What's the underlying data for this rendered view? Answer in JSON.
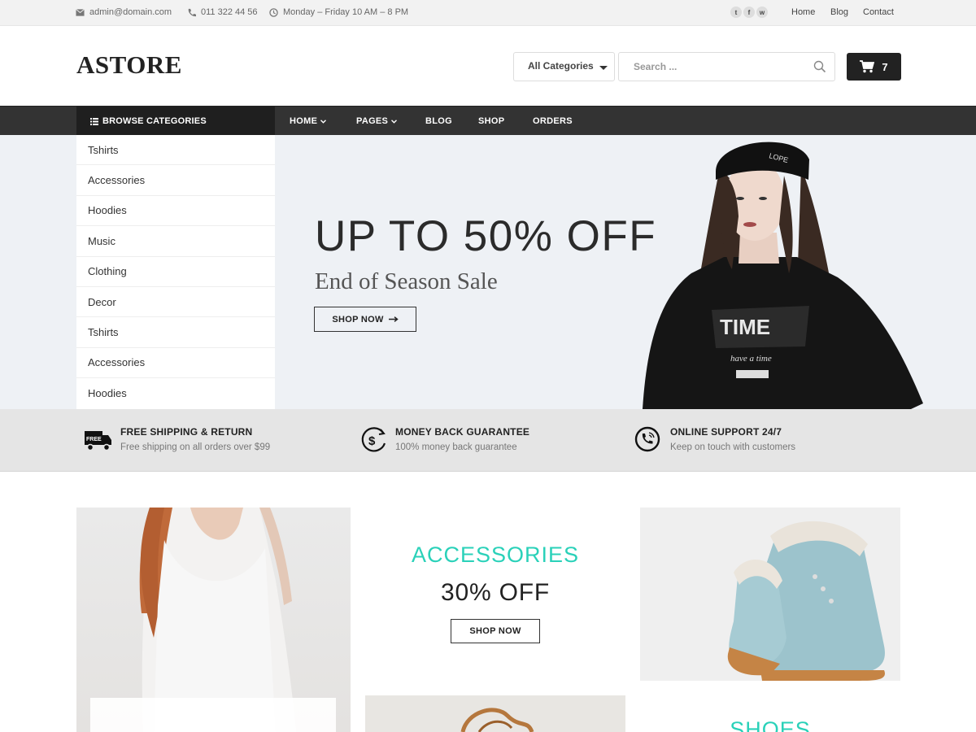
{
  "topbar": {
    "email": "admin@domain.com",
    "phone": "011 322 44 56",
    "hours": "Monday – Friday 10 AM – 8 PM",
    "social": [
      "twitter-icon",
      "facebook-icon",
      "weibo-icon"
    ],
    "links": [
      "Home",
      "Blog",
      "Contact"
    ]
  },
  "header": {
    "logo": "ASTORE",
    "category_select": "All Categories",
    "search_placeholder": "Search ...",
    "cart_count": "7"
  },
  "nav": {
    "browse_label": "BROWSE CATEGORIES",
    "items": [
      {
        "label": "HOME",
        "has_dropdown": true
      },
      {
        "label": "PAGES",
        "has_dropdown": true
      },
      {
        "label": "BLOG",
        "has_dropdown": false
      },
      {
        "label": "SHOP",
        "has_dropdown": false
      },
      {
        "label": "ORDERS",
        "has_dropdown": false
      }
    ]
  },
  "categories": [
    "Tshirts",
    "Accessories",
    "Hoodies",
    "Music",
    "Clothing",
    "Decor",
    "Tshirts",
    "Accessories",
    "Hoodies"
  ],
  "hero": {
    "title": "UP TO 50% OFF",
    "subtitle": "End of Season Sale",
    "button": "SHOP NOW",
    "background": "#eef1f5"
  },
  "features": [
    {
      "icon": "truck-icon",
      "title": "FREE SHIPPING & RETURN",
      "text": "Free shipping on all orders over $99"
    },
    {
      "icon": "money-back-icon",
      "title": "MONEY BACK GUARANTEE",
      "text": "100% money back guarantee"
    },
    {
      "icon": "support-phone-icon",
      "title": "ONLINE SUPPORT 24/7",
      "text": "Keep on touch with customers"
    }
  ],
  "promo": {
    "center_title": "ACCESSORIES",
    "center_discount": "30% OFF",
    "center_button": "SHOP NOW",
    "right_title": "SHOES",
    "accent": "#2ad1b9"
  },
  "icons": {
    "truck_badge": "FREE"
  }
}
